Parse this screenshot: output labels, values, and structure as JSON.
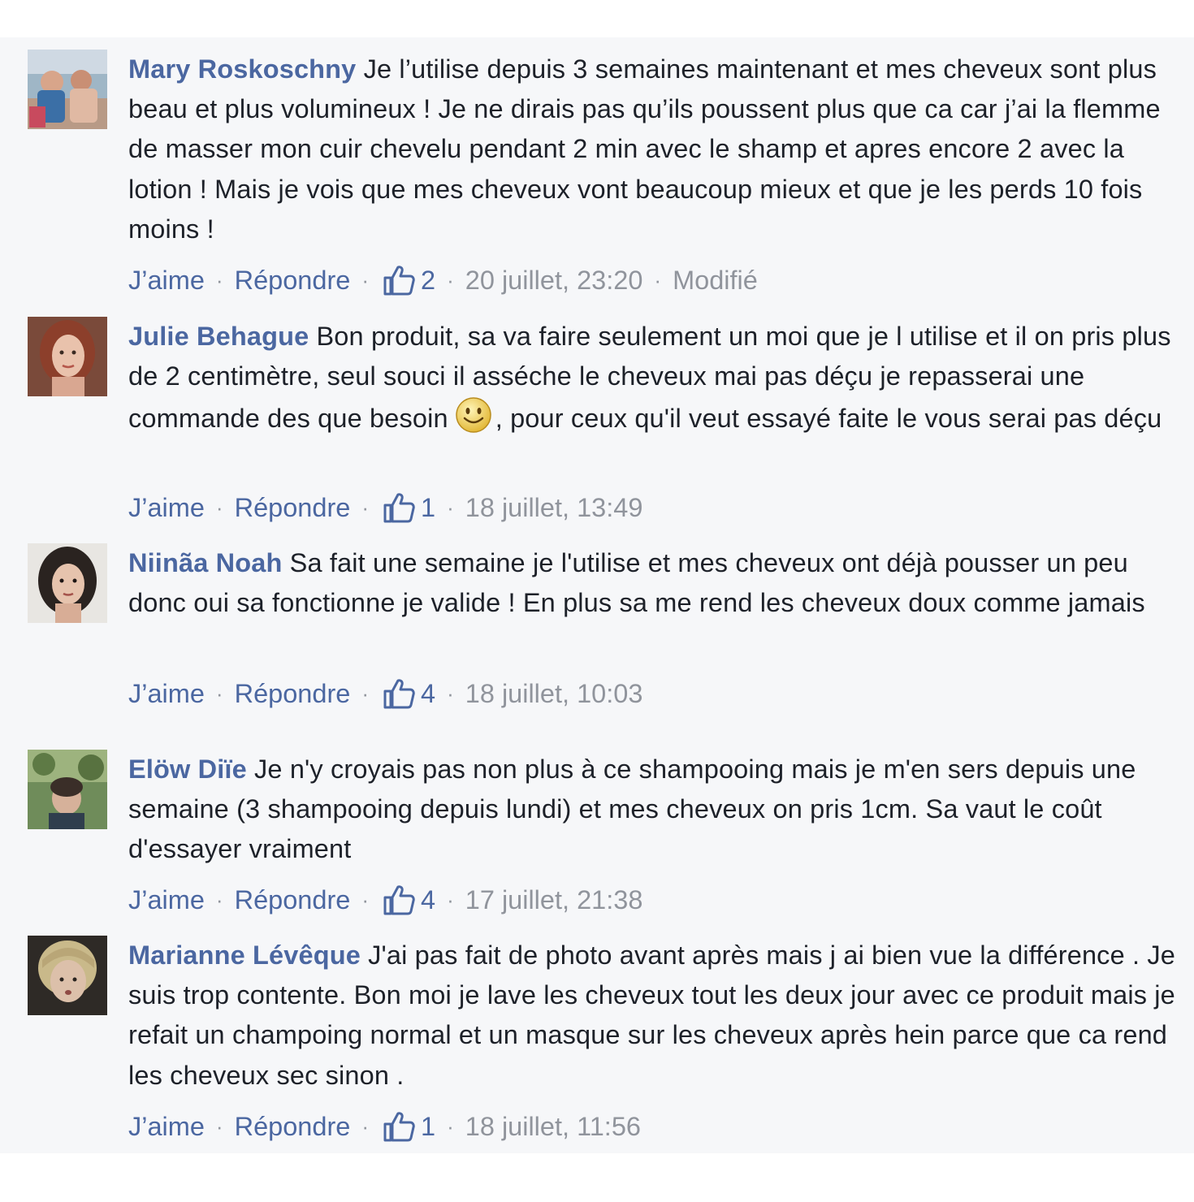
{
  "actions": {
    "like_label": "J’aime",
    "reply_label": "Répondre"
  },
  "comments": [
    {
      "author": "Mary Roskoschny",
      "text": "Je l’utilise depuis 3 semaines maintenant et mes cheveux sont plus beau et plus volumineux ! Je ne dirais pas qu’ils poussent plus que ca car j’ai la flemme de masser mon cuir chevelu pendant 2 min avec le shamp et apres encore 2 avec la lotion ! Mais je vois que mes cheveux vont beaucoup mieux et que je les perds 10 fois moins !",
      "likes": "2",
      "timestamp": "20 juillet, 23:20",
      "edited": "Modifié",
      "avatar_icon": "avatar-photo-beach"
    },
    {
      "author": "Julie Behague",
      "text": "Bon produit, sa va faire seulement un moi que je l utilise et il on pris plus de 2 centimètre, seul souci il asséche le cheveux mai pas déçu je repasserai une commande des que besoin",
      "text_after": ", pour ceux qu'il veut essayé faite le vous serai pas déçu",
      "emoji": "smiley-face-icon",
      "likes": "1",
      "timestamp": "18 juillet, 13:49",
      "avatar_icon": "avatar-photo-woman-redhair"
    },
    {
      "author": "Niinãa Noah",
      "text": "Sa fait une semaine je l'utilise et mes cheveux ont déjà pousser un peu donc oui sa fonctionne je valide ! En plus sa me rend les cheveux doux comme jamais",
      "likes": "4",
      "timestamp": "18 juillet, 10:03",
      "avatar_icon": "avatar-photo-woman-darkhair"
    },
    {
      "author": "Elöw Diïe",
      "text": "Je n'y croyais pas non plus à ce shampooing mais je m'en sers depuis une semaine (3 shampooing depuis lundi) et mes cheveux on pris 1cm. Sa vaut le coût d'essayer vraiment",
      "likes": "4",
      "timestamp": "17 juillet, 21:38",
      "avatar_icon": "avatar-photo-outdoor"
    },
    {
      "author": "Marianne Lévêque",
      "text": "J'ai pas fait de photo avant après mais j ai bien vue la différence . Je suis trop contente. Bon moi je lave les cheveux tout les deux jour avec ce produit mais je refait un champoing normal et un masque sur les cheveux après hein parce que ca rend les cheveux sec sinon .",
      "likes": "1",
      "timestamp": "18 juillet, 11:56",
      "avatar_icon": "avatar-photo-blond-short"
    }
  ],
  "colors": {
    "author": "#4b67a1",
    "text": "#1d2129",
    "meta": "#90949c",
    "background": "#f6f7f9"
  }
}
